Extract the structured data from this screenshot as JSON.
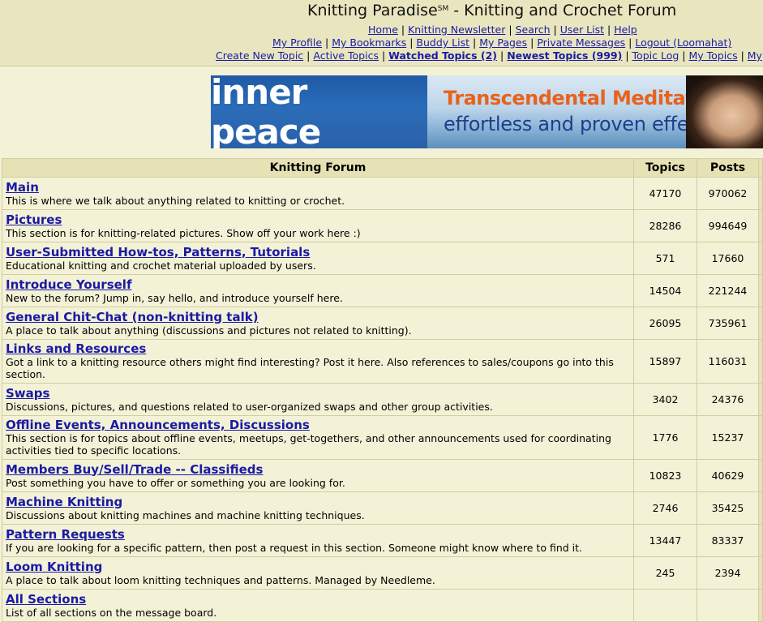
{
  "header": {
    "site_name": "Knitting Paradise",
    "site_mark": "SM",
    "site_subtitle": " - Knitting and Crochet Forum",
    "nav1": [
      "Home",
      "Knitting Newsletter",
      "Search",
      "User List",
      "Help"
    ],
    "nav2": [
      "My Profile",
      "My Bookmarks",
      "Buddy List",
      "My Pages",
      "Private Messages",
      "Logout (Loomahat)"
    ],
    "nav3": [
      {
        "label": "Create New Topic",
        "bold": false
      },
      {
        "label": "Active Topics",
        "bold": false
      },
      {
        "label": "Watched Topics (2)",
        "bold": true
      },
      {
        "label": "Newest Topics (999)",
        "bold": true
      },
      {
        "label": "Topic Log",
        "bold": false
      },
      {
        "label": "My Topics",
        "bold": false
      },
      {
        "label": "My",
        "bold": false
      }
    ],
    "separator": "|"
  },
  "banner": {
    "left_text": "inner peace",
    "brand": "Transcendental Meditation",
    "brand_mark": "®",
    "tagline": "effortless and proven effective"
  },
  "table": {
    "headers": {
      "forum": "Knitting Forum",
      "topics": "Topics",
      "posts": "Posts"
    },
    "rows": [
      {
        "name": "Main",
        "desc": "This is where we talk about anything related to knitting or crochet.",
        "topics": "47170",
        "posts": "970062"
      },
      {
        "name": "Pictures",
        "desc": "This section is for knitting-related pictures. Show off your work here :)",
        "topics": "28286",
        "posts": "994649"
      },
      {
        "name": "User-Submitted How-tos, Patterns, Tutorials",
        "desc": "Educational knitting and crochet material uploaded by users.",
        "topics": "571",
        "posts": "17660"
      },
      {
        "name": "Introduce Yourself",
        "desc": "New to the forum? Jump in, say hello, and introduce yourself here.",
        "topics": "14504",
        "posts": "221244"
      },
      {
        "name": "General Chit-Chat (non-knitting talk)",
        "desc": "A place to talk about anything (discussions and pictures not related to knitting).",
        "topics": "26095",
        "posts": "735961"
      },
      {
        "name": "Links and Resources",
        "desc": "Got a link to a knitting resource others might find interesting? Post it here. Also references to sales/coupons go into this section.",
        "topics": "15897",
        "posts": "116031"
      },
      {
        "name": "Swaps",
        "desc": "Discussions, pictures, and questions related to user-organized swaps and other group activities.",
        "topics": "3402",
        "posts": "24376"
      },
      {
        "name": "Offline Events, Announcements, Discussions",
        "desc": "This section is for topics about offline events, meetups, get-togethers, and other announcements used for coordinating activities tied to specific locations.",
        "topics": "1776",
        "posts": "15237"
      },
      {
        "name": "Members Buy/Sell/Trade -- Classifieds",
        "desc": "Post something you have to offer or something you are looking for.",
        "topics": "10823",
        "posts": "40629"
      },
      {
        "name": "Machine Knitting",
        "desc": "Discussions about knitting machines and machine knitting techniques.",
        "topics": "2746",
        "posts": "35425"
      },
      {
        "name": "Pattern Requests",
        "desc": "If you are looking for a specific pattern, then post a request in this section. Someone might know where to find it.",
        "topics": "13447",
        "posts": "83337"
      },
      {
        "name": "Loom Knitting",
        "desc": "A place to talk about loom knitting techniques and patterns. Managed by Needleme.",
        "topics": "245",
        "posts": "2394"
      },
      {
        "name": "All Sections",
        "desc": "List of all sections on the message board.",
        "topics": "",
        "posts": ""
      }
    ]
  },
  "colors": {
    "page_bg": "#f4f2d6",
    "header_bg": "#e9e6bf",
    "link": "#1a1aa6",
    "table_header_bg": "#e6e2b5",
    "banner_accent": "#e8621c"
  }
}
